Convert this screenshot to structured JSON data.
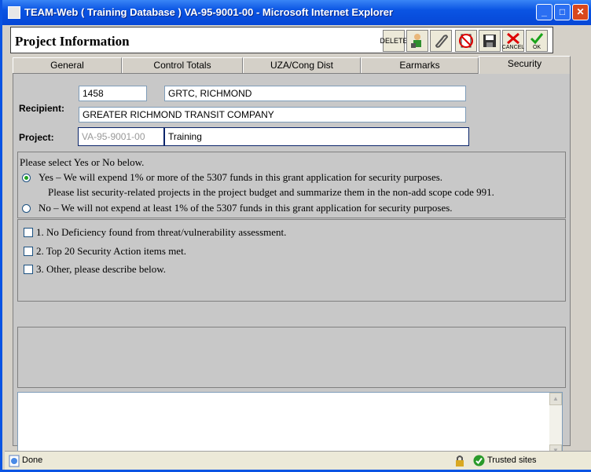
{
  "window": {
    "title": "TEAM-Web ( Training Database ) VA-95-9001-00 - Microsoft Internet Explorer",
    "buttons": [
      "_",
      "□",
      "✕"
    ]
  },
  "header": {
    "title": "Project Information",
    "toolbar": [
      {
        "icon": "delete-icon",
        "label": "DELETE"
      },
      {
        "icon": "person-tool-icon",
        "label": ""
      },
      {
        "icon": "paperclip-icon",
        "label": ""
      },
      {
        "icon": "cancel-document-icon",
        "label": ""
      },
      {
        "icon": "save-floppy-icon",
        "label": ""
      },
      {
        "icon": "cancel-x-icon",
        "label": "CANCEL"
      },
      {
        "icon": "ok-checkmark-icon",
        "label": "OK"
      }
    ]
  },
  "tabs": [
    {
      "label": "General"
    },
    {
      "label": "Control Totals"
    },
    {
      "label": "UZA/Cong Dist"
    },
    {
      "label": "Earmarks"
    },
    {
      "label": "Security",
      "active": true
    }
  ],
  "recipient": {
    "label": "Recipient:",
    "id": "1458",
    "short_name": "GRTC, RICHMOND",
    "full_name": "GREATER RICHMOND TRANSIT COMPANY"
  },
  "project": {
    "label": "Project:",
    "number": "VA-95-9001-00",
    "name": "Training"
  },
  "security": {
    "prompt": "Please select Yes or No below.",
    "yes_text": "Yes – We will expend 1% or more of the 5307 funds in this grant application for security purposes.",
    "yes_subtext": "Please list security-related projects in the project budget and summarize them in the non-add scope code 991.",
    "no_text": "No  – We will not expend at least 1% of the 5307 funds in this grant application for security purposes.",
    "selected": "yes",
    "checks": [
      {
        "label": "1. No Deficiency found from threat/vulnerability assessment.",
        "checked": false
      },
      {
        "label": "2. Top 20 Security Action items met.",
        "checked": false
      },
      {
        "label": "3. Other, please describe below.",
        "checked": false
      }
    ],
    "description": ""
  },
  "status": {
    "left": "Done",
    "zone": "Trusted sites"
  },
  "colors": {
    "title_bar": "#0a54e3",
    "panel_bg": "#c8c8c8",
    "selected_radio": "#21a121"
  }
}
